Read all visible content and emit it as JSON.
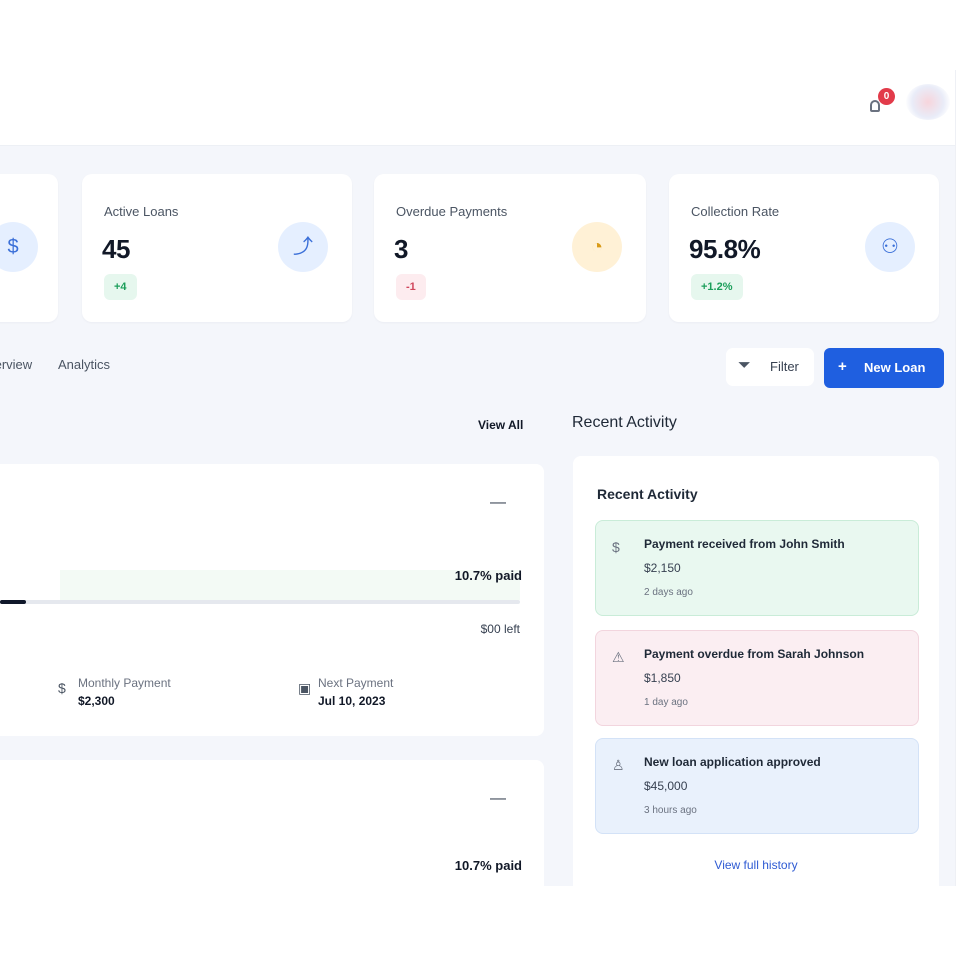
{
  "header": {
    "notification_count": "0"
  },
  "stats": [
    {
      "label": "Active Loans",
      "value": "45",
      "chip": "+4",
      "chip_color": "green",
      "icon": "trend-icon",
      "icon_glyph": "⤴"
    },
    {
      "label": "Overdue Payments",
      "value": "3",
      "chip": "-1",
      "chip_color": "red",
      "icon": "clock-icon",
      "icon_glyph": "◔"
    },
    {
      "label": "Collection Rate",
      "value": "95.8%",
      "chip": "+1.2%",
      "chip_color": "green",
      "icon": "users-icon",
      "icon_glyph": "⚇"
    }
  ],
  "tabs": [
    {
      "label": "Overview"
    },
    {
      "label": "Analytics"
    }
  ],
  "actions": {
    "filter_label": "Filter",
    "new_loan_label": "New Loan"
  },
  "loans_section": {
    "view_all": "View All"
  },
  "loans": [
    {
      "menu": "—",
      "paid": "10.7% paid",
      "progress": 0.05,
      "remaining": "$00 left",
      "monthly_label": "Monthly Payment",
      "monthly_value": "$2,300",
      "next_label": "Next Payment",
      "next_value": "Jul 10, 2023"
    },
    {
      "menu": "—",
      "paid": "10.7% paid"
    }
  ],
  "activity": {
    "title": "Recent Activity",
    "subtitle": "Recent Activity",
    "items": [
      {
        "icon": "dollar-icon",
        "glyph": "$",
        "title": "Payment received from John Smith",
        "amount": "$2,150",
        "date": "2 days ago",
        "tone": "green"
      },
      {
        "icon": "warning-icon",
        "glyph": "⚠",
        "title": "Payment overdue from Sarah Johnson",
        "amount": "$1,850",
        "date": "1 day ago",
        "tone": "pink"
      },
      {
        "icon": "user-icon",
        "glyph": "♙",
        "title": "New loan application approved",
        "amount": "$45,000",
        "date": "3 hours ago",
        "tone": "blue"
      }
    ],
    "view_history": "View full history"
  },
  "colors": {
    "primary": "#1f5fe0",
    "success": "#1b9e5a",
    "danger": "#e23b4a",
    "page_bg": "#f4f6fb"
  }
}
